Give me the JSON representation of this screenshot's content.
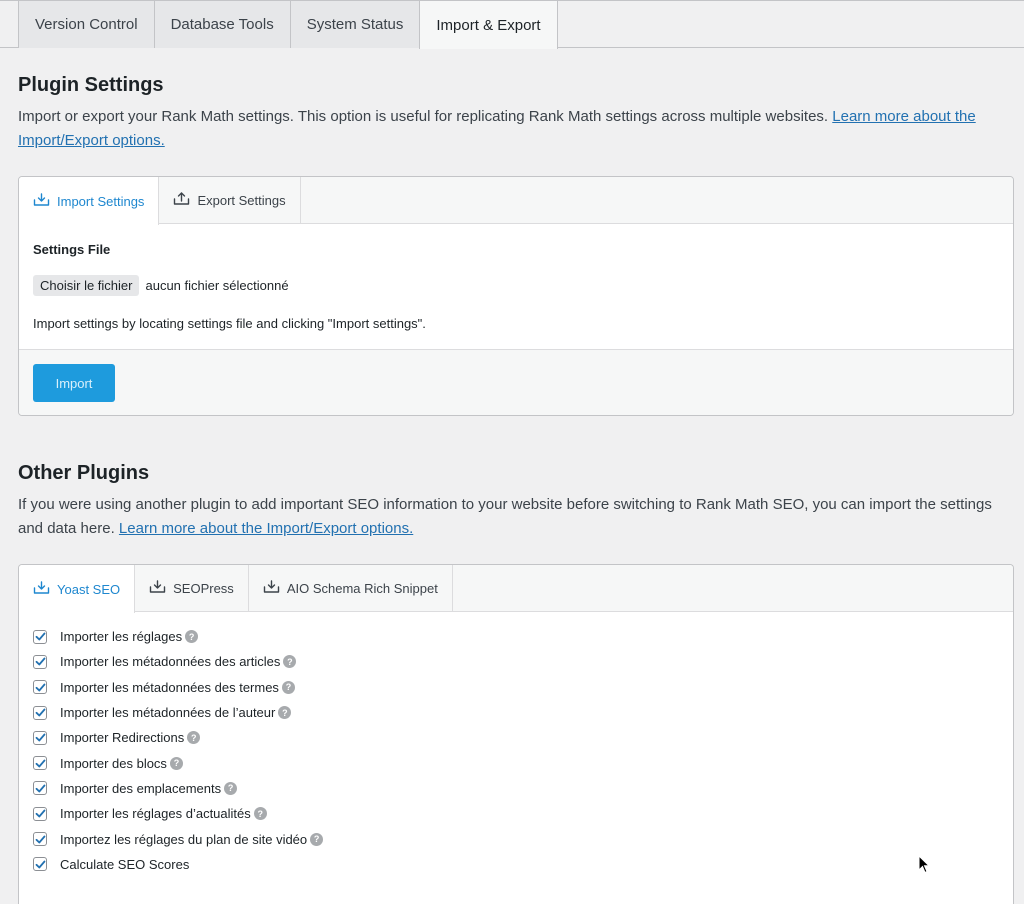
{
  "top_tabs": [
    {
      "label": "Version Control"
    },
    {
      "label": "Database Tools"
    },
    {
      "label": "System Status"
    },
    {
      "label": "Import & Export",
      "active": true
    }
  ],
  "plugin_settings": {
    "title": "Plugin Settings",
    "description": "Import or export your Rank Math settings. This option is useful for replicating Rank Math settings across multiple websites.",
    "link": "Learn more about the Import/Export options.",
    "tabs": [
      {
        "label": "Import Settings",
        "icon": "import-icon",
        "active": true
      },
      {
        "label": "Export Settings",
        "icon": "export-icon"
      }
    ],
    "settings_file_label": "Settings File",
    "choose_file_button": "Choisir le fichier",
    "no_file_text": "aucun fichier sélectionné",
    "hint": "Import settings by locating settings file and clicking \"Import settings\".",
    "import_button": "Import"
  },
  "other_plugins": {
    "title": "Other Plugins",
    "description": "If you were using another plugin to add important SEO information to your website before switching to Rank Math SEO, you can import the settings and data here.",
    "link": "Learn more about the Import/Export options.",
    "tabs": [
      {
        "label": "Yoast SEO",
        "icon": "import-icon",
        "active": true
      },
      {
        "label": "SEOPress",
        "icon": "import-icon"
      },
      {
        "label": "AIO Schema Rich Snippet",
        "icon": "import-icon"
      }
    ],
    "options": [
      {
        "label": "Importer les réglages",
        "checked": true,
        "help": true
      },
      {
        "label": "Importer les métadonnées des articles",
        "checked": true,
        "help": true
      },
      {
        "label": "Importer les métadonnées des termes",
        "checked": true,
        "help": true
      },
      {
        "label": "Importer les métadonnées de l’auteur",
        "checked": true,
        "help": true
      },
      {
        "label": "Importer Redirections",
        "checked": true,
        "help": true
      },
      {
        "label": "Importer des blocs",
        "checked": true,
        "help": true
      },
      {
        "label": "Importer des emplacements",
        "checked": true,
        "help": true
      },
      {
        "label": "Importer les réglages d’actualités",
        "checked": true,
        "help": true
      },
      {
        "label": "Importez les réglages du plan de site vidéo",
        "checked": true,
        "help": true
      },
      {
        "label": "Calculate SEO Scores",
        "checked": true,
        "help": false
      }
    ]
  },
  "colors": {
    "accent": "#1e87cf",
    "button": "#1e9bdd",
    "link": "#2271b1"
  }
}
